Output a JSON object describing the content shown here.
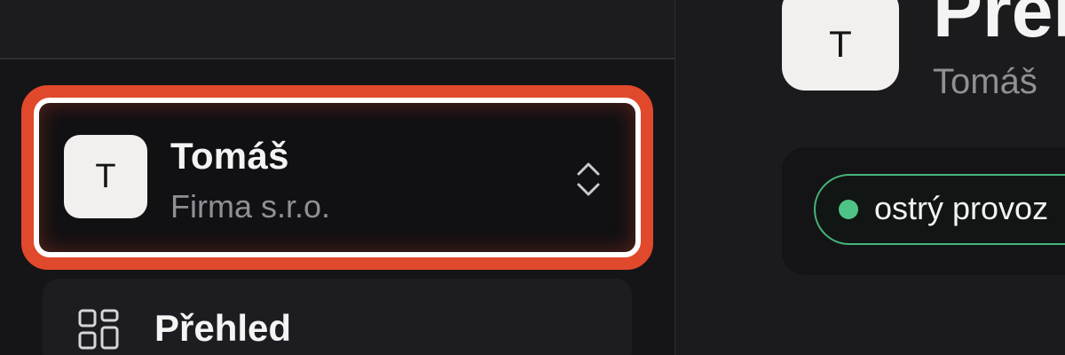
{
  "sidebar": {
    "workspace": {
      "avatar_letter": "T",
      "name": "Tomáš",
      "company": "Firma s.r.o."
    },
    "nav": [
      {
        "label": "Přehled",
        "icon": "dashboard-grid-icon"
      }
    ]
  },
  "main": {
    "avatar_letter": "T",
    "title": "Přehled",
    "subtitle": "Tomáš",
    "status": {
      "label": "ostrý provoz",
      "color": "#4fc386"
    }
  },
  "colors": {
    "highlight": "#e0492c",
    "background": "#1a1a1d",
    "status_green": "#4fc386"
  }
}
